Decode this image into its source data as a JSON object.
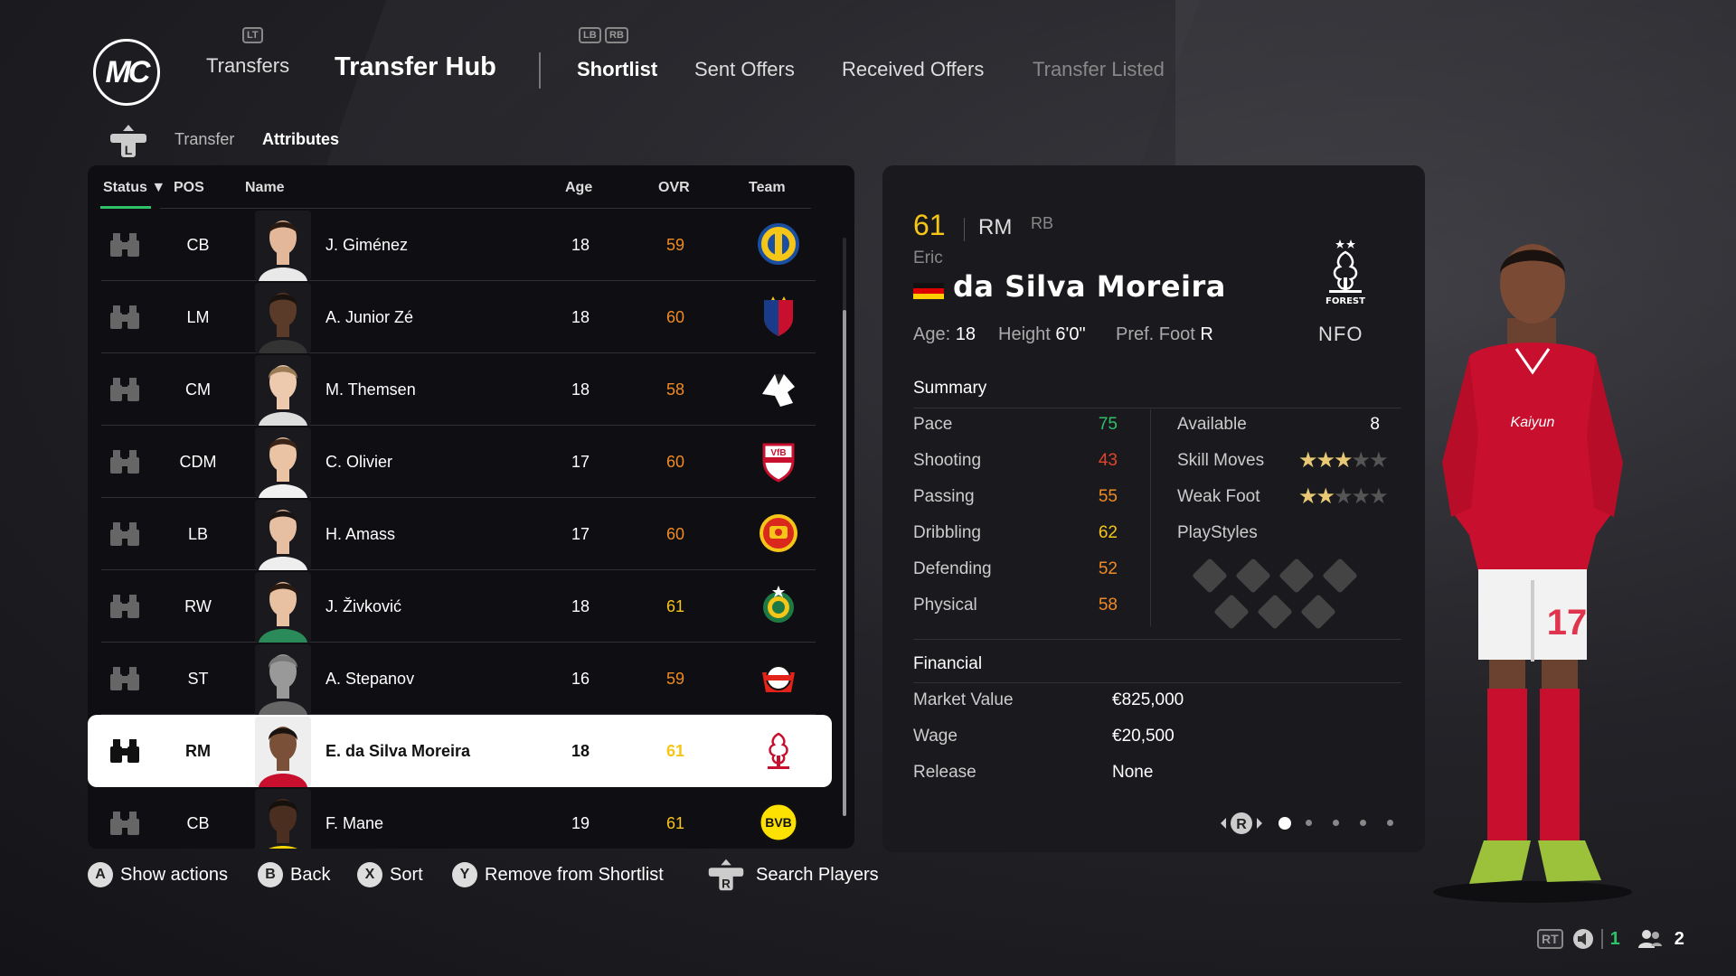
{
  "header": {
    "logo_text": "MC",
    "lt_hint": "LT",
    "transfers_label": "Transfers",
    "hub_label": "Transfer Hub",
    "lb_hint": "LB",
    "rb_hint": "RB",
    "tabs": [
      {
        "label": "Shortlist",
        "state": "active"
      },
      {
        "label": "Sent Offers",
        "state": "normal"
      },
      {
        "label": "Received Offers",
        "state": "normal"
      },
      {
        "label": "Transfer Listed",
        "state": "disabled"
      }
    ]
  },
  "breadcrumb": {
    "icon_hint": "L",
    "items": [
      "Transfer",
      "Attributes"
    ]
  },
  "table": {
    "headers": {
      "status": "Status ▼",
      "pos": "POS",
      "name": "Name",
      "age": "Age",
      "ovr": "OVR",
      "team": "Team"
    },
    "rows": [
      {
        "pos": "CB",
        "name": "J. Giménez",
        "age": "18",
        "ovr": "59",
        "ovr_color": "#f08a24",
        "team": "Rosario Central",
        "skin": "#e3b89a",
        "hair": "#2a1a12",
        "shirt": "#e9e9e9"
      },
      {
        "pos": "LM",
        "name": "A. Junior Zé",
        "age": "18",
        "ovr": "60",
        "ovr_color": "#f08a24",
        "team": "FC Basel",
        "skin": "#5a3a28",
        "hair": "#1a120e",
        "shirt": "#333"
      },
      {
        "pos": "CM",
        "name": "M. Themsen",
        "age": "18",
        "ovr": "58",
        "ovr_color": "#f08a24",
        "team": "Randers FC",
        "skin": "#edc9ad",
        "hair": "#9b7b56",
        "shirt": "#ddd"
      },
      {
        "pos": "CDM",
        "name": "C. Olivier",
        "age": "17",
        "ovr": "60",
        "ovr_color": "#f08a24",
        "team": "VfB Stuttgart",
        "skin": "#eac3a5",
        "hair": "#3a2418",
        "shirt": "#f0f0f0"
      },
      {
        "pos": "LB",
        "name": "H. Amass",
        "age": "17",
        "ovr": "60",
        "ovr_color": "#f08a24",
        "team": "Manchester United",
        "skin": "#e6bfa2",
        "hair": "#1c1410",
        "shirt": "#eee"
      },
      {
        "pos": "RW",
        "name": "J. Živković",
        "age": "18",
        "ovr": "61",
        "ovr_color": "#f5c518",
        "team": "Rapid Wien",
        "skin": "#e8c0a2",
        "hair": "#2a1a10",
        "shirt": "#2a8a5a"
      },
      {
        "pos": "ST",
        "name": "A. Stepanov",
        "age": "16",
        "ovr": "59",
        "ovr_color": "#f08a24",
        "team": "Bayer Leverkusen",
        "skin": "#999",
        "hair": "#777",
        "shirt": "#666"
      },
      {
        "pos": "RM",
        "name": "E. da Silva Moreira",
        "age": "18",
        "ovr": "61",
        "ovr_color": "#f5c518",
        "team": "Nottingham Forest",
        "skin": "#7a5038",
        "hair": "#1a120e",
        "shirt": "#c8102e",
        "selected": true
      },
      {
        "pos": "CB",
        "name": "F. Mane",
        "age": "19",
        "ovr": "61",
        "ovr_color": "#f5c518",
        "team": "Borussia Dortmund",
        "skin": "#4a2e20",
        "hair": "#16100c",
        "shirt": "#f5d400"
      }
    ]
  },
  "detail": {
    "ovr": "61",
    "position": "RM",
    "alt_position": "RB",
    "first_name": "Eric",
    "last_name": "da Silva Moreira",
    "age_label": "Age:",
    "age": "18",
    "height_label": "Height",
    "height": "6'0\"",
    "foot_label": "Pref. Foot",
    "foot": "R",
    "team_abbr": "NFO",
    "summary_title": "Summary",
    "stats": [
      {
        "label": "Pace",
        "value": "75",
        "color": "#2fc06a"
      },
      {
        "label": "Shooting",
        "value": "43",
        "color": "#e0442b"
      },
      {
        "label": "Passing",
        "value": "55",
        "color": "#f08a24"
      },
      {
        "label": "Dribbling",
        "value": "62",
        "color": "#f5c518"
      },
      {
        "label": "Defending",
        "value": "52",
        "color": "#f08a24"
      },
      {
        "label": "Physical",
        "value": "58",
        "color": "#f08a24"
      }
    ],
    "available_label": "Available",
    "available": "8",
    "skill_moves_label": "Skill Moves",
    "skill_moves": 3,
    "weak_foot_label": "Weak Foot",
    "weak_foot": 2,
    "playstyles_label": "PlayStyles",
    "financial_title": "Financial",
    "financial": [
      {
        "label": "Market Value",
        "value": "€825,000"
      },
      {
        "label": "Wage",
        "value": "€20,500"
      },
      {
        "label": "Release",
        "value": "None"
      }
    ],
    "pager_hint": "R",
    "pages": 5,
    "current_page": 1
  },
  "footer": {
    "actions": [
      {
        "key": "A",
        "label": "Show actions"
      },
      {
        "key": "B",
        "label": "Back"
      },
      {
        "key": "X",
        "label": "Sort"
      },
      {
        "key": "Y",
        "label": "Remove from Shortlist"
      },
      {
        "key": "R",
        "label": "Search Players"
      }
    ],
    "rt_hint": "RT",
    "mic_count": "1",
    "users_count": "2"
  },
  "colors": {
    "accent_green": "#2fc06a",
    "gold": "#f5c518",
    "orange": "#f08a24",
    "forest_red": "#c8102e"
  }
}
